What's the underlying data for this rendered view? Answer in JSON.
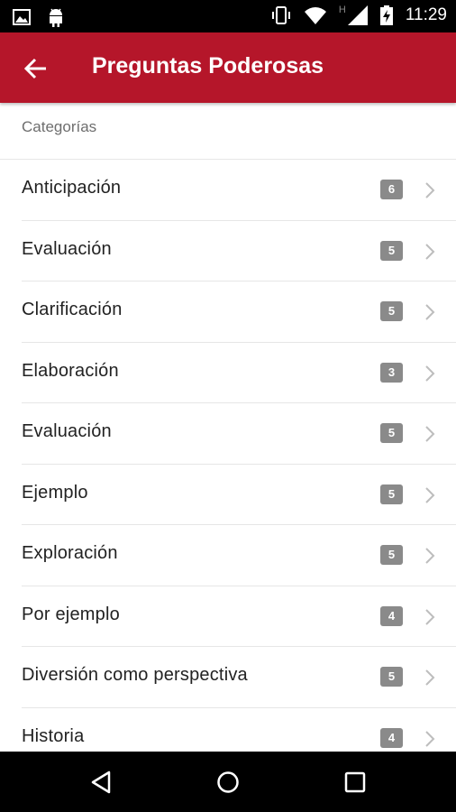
{
  "status_bar": {
    "time": "11:29",
    "network_label": "H",
    "icons": [
      "image-icon",
      "android-icon",
      "vibrate-icon",
      "wifi-icon",
      "signal-icon",
      "battery-charging-icon"
    ]
  },
  "app_bar": {
    "title": "Preguntas Poderosas",
    "back_icon": "arrow-back-icon",
    "color": "#b5162a"
  },
  "section": {
    "header": "Categorías"
  },
  "categories": [
    {
      "label": "Anticipación",
      "count": "6"
    },
    {
      "label": "Evaluación",
      "count": "5"
    },
    {
      "label": "Clarificación",
      "count": "5"
    },
    {
      "label": "Elaboración",
      "count": "3"
    },
    {
      "label": "Evaluación",
      "count": "5"
    },
    {
      "label": "Ejemplo",
      "count": "5"
    },
    {
      "label": "Exploración",
      "count": "5"
    },
    {
      "label": "Por ejemplo",
      "count": "4"
    },
    {
      "label": "Diversión como perspectiva",
      "count": "5"
    },
    {
      "label": "Historia",
      "count": "4"
    }
  ],
  "nav_bar": {
    "icons": [
      "back-triangle-icon",
      "home-circle-icon",
      "recents-square-icon"
    ]
  }
}
